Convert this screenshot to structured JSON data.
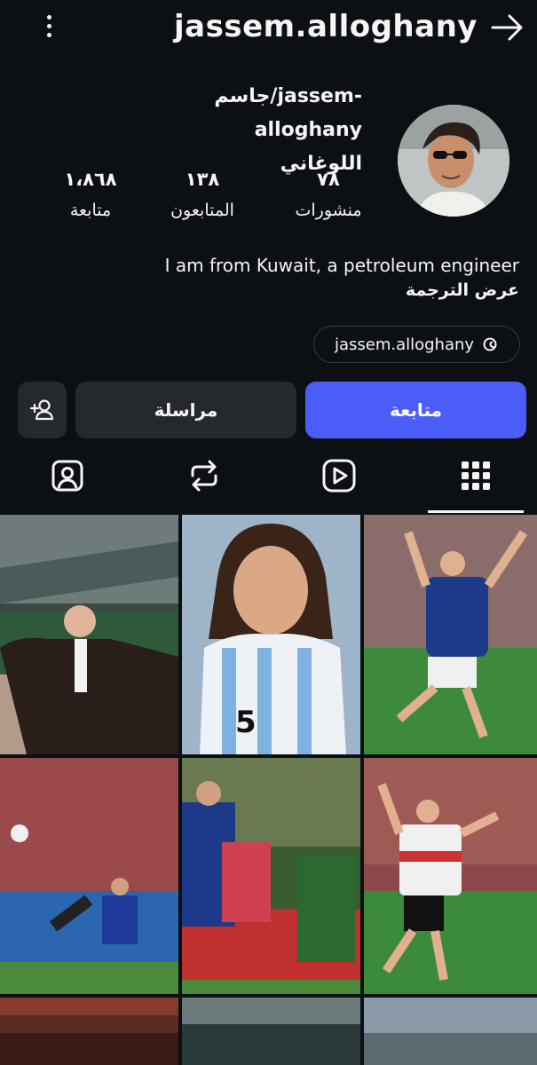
{
  "header": {
    "username": "jassem.alloghany",
    "menu_icon": "kebab-menu-icon",
    "share_icon": "arrow-right-icon"
  },
  "profile": {
    "full_name_line1": "جاسم/jassem-alloghany",
    "full_name_line2": "اللوغاني",
    "stats": {
      "posts_value": "٧٨",
      "posts_label": "منشورات",
      "followers_value": "١٣٨",
      "followers_label": "المتابعون",
      "following_value": "١،٨٦٨",
      "following_label": "متابعة"
    },
    "bio": "I am from Kuwait, a petroleum engineer",
    "see_translation": "عرض الترجمة",
    "threads_handle": "jassem.alloghany"
  },
  "actions": {
    "follow_label": "متابعة",
    "message_label": "مراسلة"
  },
  "tabs": [
    {
      "icon": "tagged-icon"
    },
    {
      "icon": "reposts-icon"
    },
    {
      "icon": "reels-icon"
    },
    {
      "icon": "grid-icon",
      "active": true
    }
  ],
  "colors": {
    "background": "#0c1014",
    "follow_button": "#4a5df9",
    "secondary_button": "#25292e"
  }
}
